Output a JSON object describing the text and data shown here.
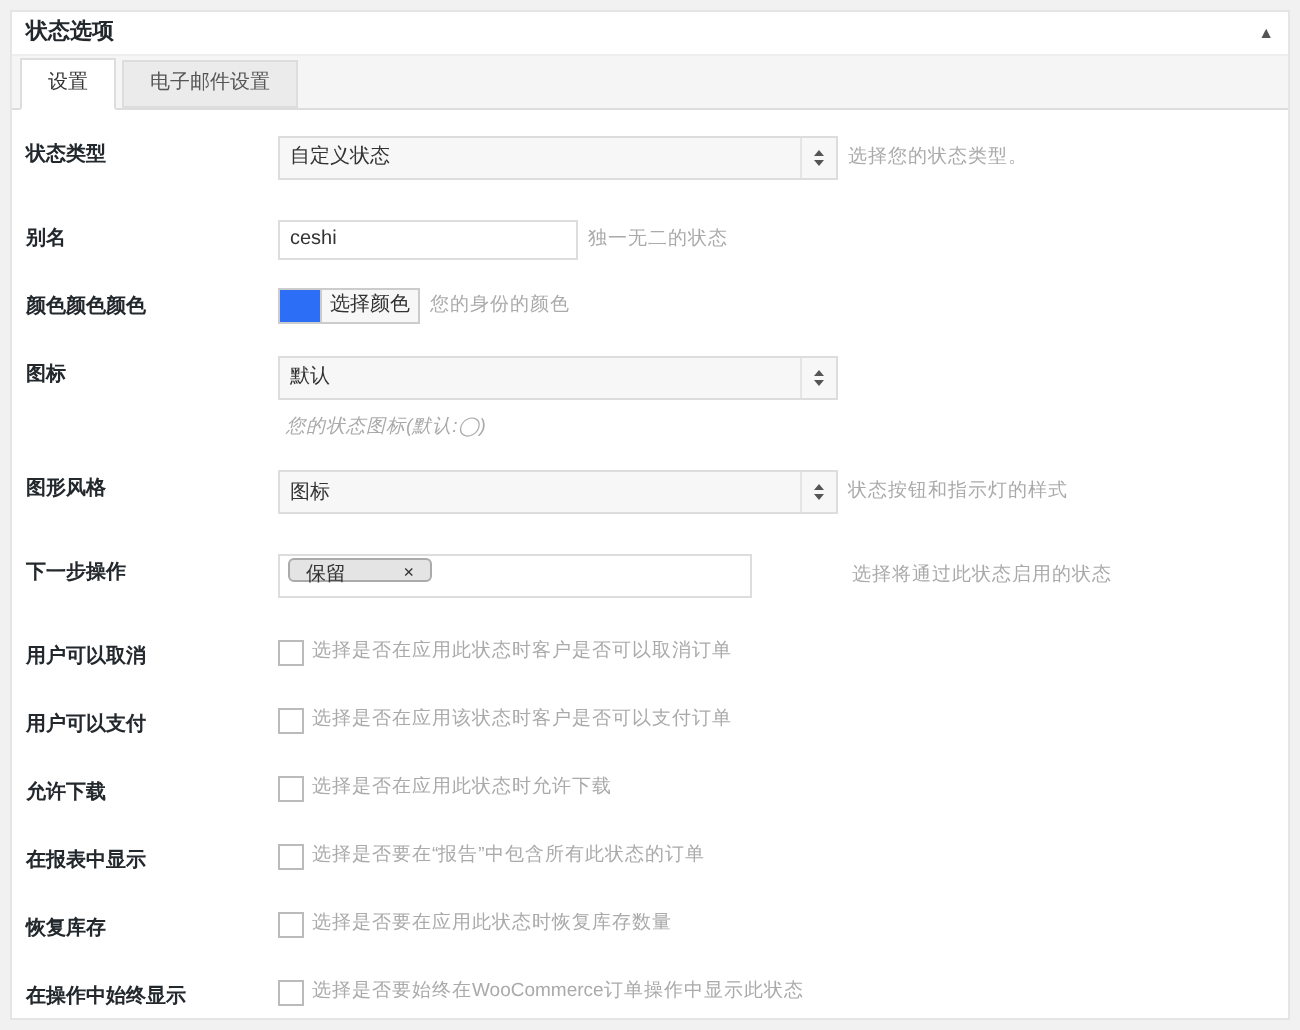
{
  "panel": {
    "title": "状态选项",
    "collapse_arrow": "▲"
  },
  "tabs": [
    {
      "label": "设置",
      "selected": true
    },
    {
      "label": "电子邮件设置",
      "selected": false
    }
  ],
  "fields": [
    {
      "kind": "select",
      "label": "状态类型",
      "value": "自定义状态",
      "description": "选择您的状态类型。"
    },
    {
      "kind": "text",
      "label": "别名",
      "value": "ceshi",
      "description": "独一无二的状态"
    },
    {
      "kind": "color",
      "label": "颜色颜色颜色",
      "color": "#2c6ff6",
      "button": "选择颜色",
      "description": "您的身份的颜色"
    },
    {
      "kind": "select",
      "label": "图标",
      "value": "默认",
      "note": "您的状态图标(默认:◯)"
    },
    {
      "kind": "select",
      "label": "图形风格",
      "value": "图标",
      "description": "状态按钮和指示灯的样式"
    },
    {
      "kind": "tags",
      "label": "下一步操作",
      "tags": [
        {
          "text": "保留",
          "remove": "×"
        }
      ],
      "description": "选择将通过此状态启用的状态"
    },
    {
      "kind": "checkbox",
      "label": "用户可以取消",
      "checked": false,
      "description": "选择是否在应用此状态时客户是否可以取消订单"
    },
    {
      "kind": "checkbox",
      "label": "用户可以支付",
      "checked": false,
      "description": "选择是否在应用该状态时客户是否可以支付订单"
    },
    {
      "kind": "checkbox",
      "label": "允许下载",
      "checked": false,
      "description": "选择是否在应用此状态时允许下载"
    },
    {
      "kind": "checkbox",
      "label": "在报表中显示",
      "checked": false,
      "description": "选择是否要在“报告”中包含所有此状态的订单"
    },
    {
      "kind": "checkbox",
      "label": "恢复库存",
      "checked": false,
      "description": "选择是否要在应用此状态时恢复库存数量"
    },
    {
      "kind": "checkbox",
      "label": "在操作中始终显示",
      "checked": false,
      "description": "选择是否要始终在WooCommerce订单操作中显示此状态"
    }
  ]
}
